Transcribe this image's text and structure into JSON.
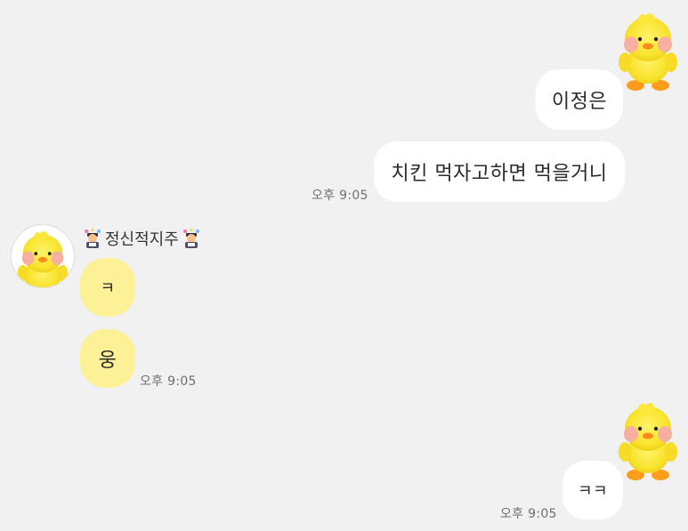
{
  "chat": {
    "messages_out_1": {
      "bubble_1": "이정은",
      "bubble_2": "치킨 먹자고하면 먹을거니",
      "time": "오후 9:05"
    },
    "messages_in_1": {
      "sender": "정신적지주",
      "bubble_1": "ㅋ",
      "bubble_2": "웅",
      "time": "오후 9:05"
    },
    "messages_out_2": {
      "bubble_1": "ㅋㅋ",
      "time": "오후 9:05"
    }
  },
  "icons": {
    "profile_out": "yellow-duck-plush-icon",
    "profile_in": "yellow-duck-plush-icon",
    "name_emoji": "student-with-bubbles-emoji"
  },
  "colors": {
    "background": "#f1f1f1",
    "outgoing_bubble": "#ffffff",
    "incoming_bubble": "#fdf197",
    "timestamp": "#6f6f6f"
  }
}
